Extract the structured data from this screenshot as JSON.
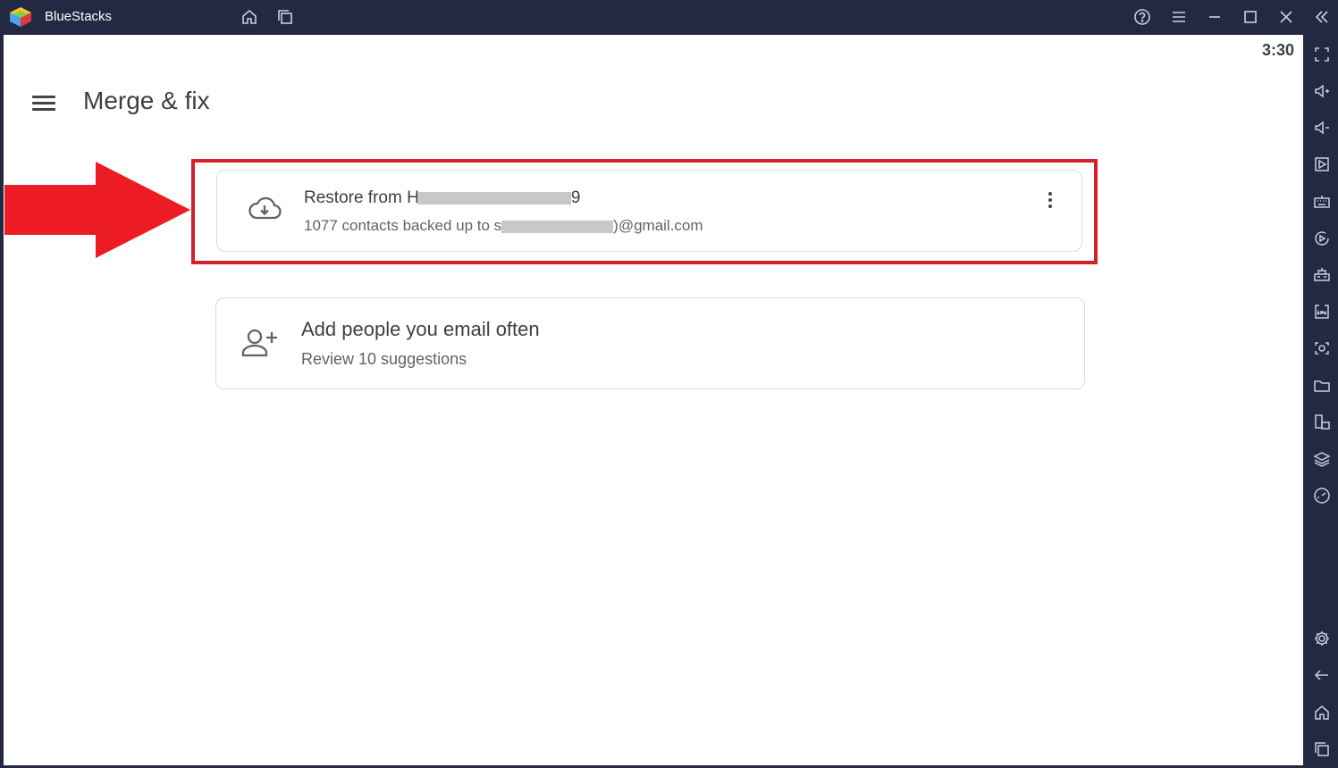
{
  "window": {
    "app_name": "BlueStacks",
    "colors": {
      "chrome": "#232943",
      "icon": "#c9cde0",
      "highlight": "#d4202a",
      "arrow": "#ed1c24"
    }
  },
  "titlebar": {
    "icons": [
      "home-icon",
      "multi-instance-icon",
      "help-icon",
      "menu-icon",
      "minimize-icon",
      "maximize-icon",
      "close-icon",
      "collapse-sidebar-icon"
    ]
  },
  "android": {
    "status_time": "3:30"
  },
  "header": {
    "title": "Merge & fix",
    "menu_icon": "hamburger-icon"
  },
  "cards": [
    {
      "icon": "cloud-download-icon",
      "title_prefix": "Restore from H",
      "title_suffix": "9",
      "subtitle_prefix": "1077 contacts backed up to s",
      "subtitle_suffix": ")@gmail.com",
      "more_icon": "more-vert-icon"
    },
    {
      "icon": "person-add-icon",
      "title": "Add people you email often",
      "subtitle": "Review 10 suggestions"
    }
  ],
  "sidebar": {
    "icons": [
      "fullscreen-icon",
      "volume-up-icon",
      "volume-down-icon",
      "screen-cast-icon",
      "keyboard-icon",
      "macro-icon",
      "game-controls-icon",
      "apk-install-icon",
      "screenshot-icon",
      "folder-icon",
      "multi-display-icon",
      "layers-icon",
      "performance-icon",
      "settings-icon",
      "back-icon",
      "home-icon",
      "recent-apps-icon"
    ]
  }
}
